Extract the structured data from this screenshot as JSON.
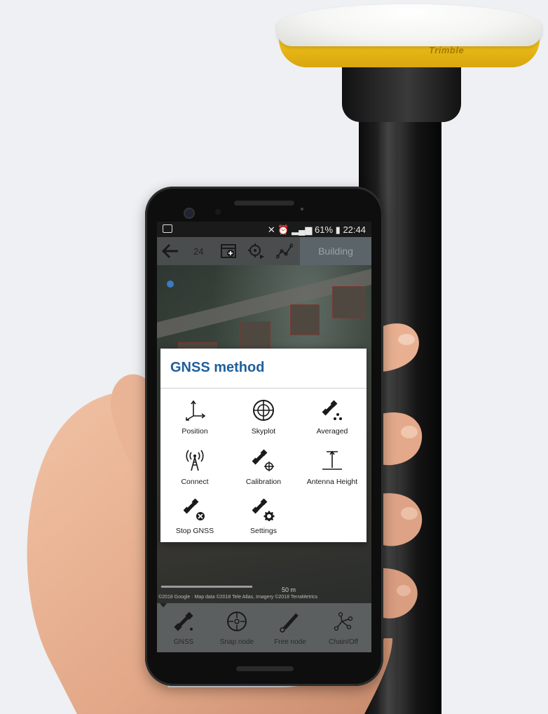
{
  "status_bar": {
    "battery": "61%",
    "time": "22:44"
  },
  "toolbar": {
    "count": "24",
    "layer_tab": "Building"
  },
  "map": {
    "scale_label": "50 m",
    "attribution": "©2018 Google · Map data ©2018 Tele Atlas, Imagery ©2018 TerraMetrics"
  },
  "dialog": {
    "title": "GNSS method",
    "options": [
      {
        "label": "Position",
        "icon": "position-axes-icon"
      },
      {
        "label": "Skyplot",
        "icon": "skyplot-crosshair-icon"
      },
      {
        "label": "Averaged",
        "icon": "satellite-averaged-icon"
      },
      {
        "label": "Connect",
        "icon": "antenna-tower-icon"
      },
      {
        "label": "Calibration",
        "icon": "satellite-calibration-icon"
      },
      {
        "label": "Antenna Height",
        "icon": "antenna-height-icon"
      },
      {
        "label": "Stop GNSS",
        "icon": "satellite-stop-icon"
      },
      {
        "label": "Settings",
        "icon": "satellite-settings-icon"
      }
    ]
  },
  "bottom_nav": [
    {
      "label": "GNSS",
      "icon": "satellite-icon"
    },
    {
      "label": "Snap node",
      "icon": "snap-crosshair-icon"
    },
    {
      "label": "Free node",
      "icon": "pen-icon"
    },
    {
      "label": "Chain/Off",
      "icon": "chain-nodes-icon"
    }
  ],
  "receiver": {
    "brand": "Trimble"
  },
  "colors": {
    "dialog_title": "#1f5e9c",
    "receiver_yellow": "#f0c21b",
    "map_pin": "#3d7ac4"
  }
}
